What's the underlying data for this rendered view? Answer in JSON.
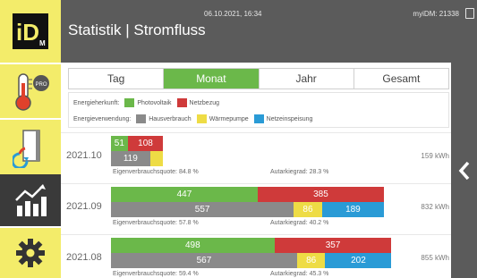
{
  "header": {
    "title": "Statistik | Stromfluss",
    "datetime": "06.10.2021, 16:34",
    "device": "myiDM: 21338"
  },
  "sidebar": {
    "logo_text": "iD",
    "logo_subtext": "M",
    "thermo_badge": "PRO",
    "items": [
      {
        "name": "thermometer-pro",
        "icon": "thermometer-icon"
      },
      {
        "name": "door-energy",
        "icon": "door-icon"
      },
      {
        "name": "statistics",
        "icon": "chart-icon",
        "active": true
      },
      {
        "name": "settings",
        "icon": "gear-icon"
      }
    ]
  },
  "tabs": [
    {
      "label": "Tag",
      "active": false
    },
    {
      "label": "Monat",
      "active": true
    },
    {
      "label": "Jahr",
      "active": false
    },
    {
      "label": "Gesamt",
      "active": false
    }
  ],
  "legend": {
    "herkunft_label": "Energieherkunft:",
    "herkunft_items": [
      {
        "label": "Photovoltaik",
        "color": "#6bb84a"
      },
      {
        "label": "Netzbezug",
        "color": "#cf3a3a"
      }
    ],
    "verwendung_label": "Energieverwendung:",
    "verwendung_items": [
      {
        "label": "Hausverbrauch",
        "color": "#8a8a8a"
      },
      {
        "label": "Wärmepumpe",
        "color": "#eedc45"
      },
      {
        "label": "Netzeinspeisung",
        "color": "#2a9bd6"
      }
    ]
  },
  "colors": {
    "pv": "#6bb84a",
    "netz": "#cf3a3a",
    "haus": "#8a8a8a",
    "wp": "#eedc45",
    "einspeisung": "#2a9bd6",
    "accent": "#6bb84a",
    "header_bg": "#5b5b5b",
    "sidebar_bg": "#f3ec6a"
  },
  "months": [
    {
      "label": "2021.10",
      "total": "159 kWh",
      "herkunft": [
        {
          "key": "pv",
          "value": 51,
          "label": "51"
        },
        {
          "key": "netz",
          "value": 108,
          "label": "108"
        }
      ],
      "verwendung": [
        {
          "key": "haus",
          "value": 119,
          "label": "119"
        },
        {
          "key": "wp",
          "value": 40,
          "label": ""
        },
        {
          "key": "einspeisung",
          "value": 0,
          "label": ""
        }
      ],
      "eigenverbrauch": "Eigenverbrauchsquote: 84.8 %",
      "autarkie": "Autarkiegrad: 28.3 %"
    },
    {
      "label": "2021.09",
      "total": "832 kWh",
      "herkunft": [
        {
          "key": "pv",
          "value": 447,
          "label": "447"
        },
        {
          "key": "netz",
          "value": 385,
          "label": "385"
        }
      ],
      "verwendung": [
        {
          "key": "haus",
          "value": 557,
          "label": "557"
        },
        {
          "key": "wp",
          "value": 86,
          "label": "86"
        },
        {
          "key": "einspeisung",
          "value": 189,
          "label": "189"
        }
      ],
      "eigenverbrauch": "Eigenverbrauchsquote: 57.8 %",
      "autarkie": "Autarkiegrad: 40.2 %"
    },
    {
      "label": "2021.08",
      "total": "855 kWh",
      "herkunft": [
        {
          "key": "pv",
          "value": 498,
          "label": "498"
        },
        {
          "key": "netz",
          "value": 357,
          "label": "357"
        }
      ],
      "verwendung": [
        {
          "key": "haus",
          "value": 567,
          "label": "567"
        },
        {
          "key": "wp",
          "value": 86,
          "label": "86"
        },
        {
          "key": "einspeisung",
          "value": 202,
          "label": "202"
        }
      ],
      "eigenverbrauch": "Eigenverbrauchsquote: 59.4 %",
      "autarkie": "Autarkiegrad: 45.3 %"
    }
  ],
  "scale_max_kwh": 900,
  "right_handle_icon": "chevron-left-icon"
}
